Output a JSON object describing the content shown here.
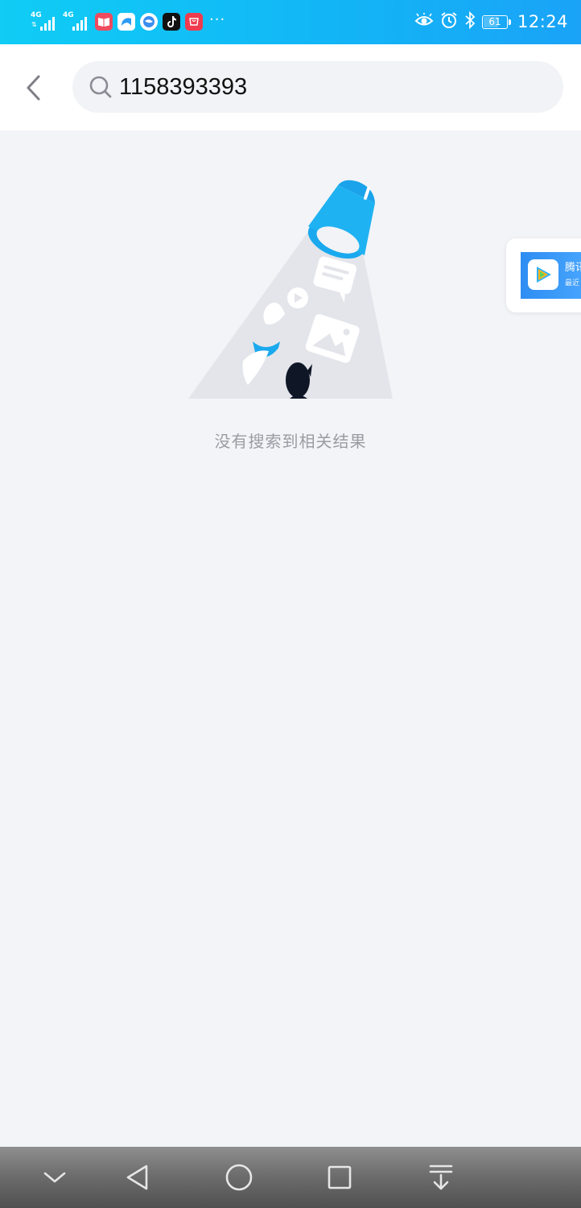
{
  "status_bar": {
    "network_1": "4G",
    "network_2": "4G",
    "more": "···",
    "battery_level": 61,
    "battery_text": "61",
    "time": "12:24"
  },
  "search": {
    "query": "1158393393"
  },
  "empty_state": {
    "message": "没有搜索到相关结果"
  },
  "floating_card": {
    "title": "腾讯",
    "subtitle": "最近"
  },
  "colors": {
    "status_bar": "#12b6f6",
    "accent_blue": "#1eaaf1",
    "page_bg": "#f3f4f8",
    "hint_text": "#9a9ca3"
  },
  "icons": {
    "back": "chevron-left-icon",
    "search": "search-icon",
    "nav": [
      "collapse-icon",
      "back-triangle-icon",
      "home-circle-icon",
      "recents-square-icon",
      "notification-pull-icon"
    ]
  }
}
